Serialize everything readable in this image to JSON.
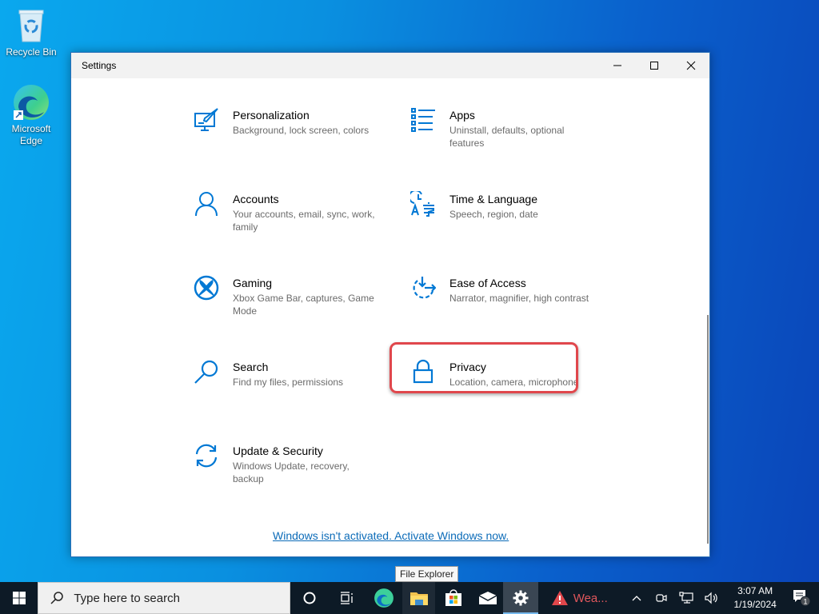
{
  "desktop": {
    "icons": [
      {
        "label": "Recycle Bin",
        "icon": "recycle-bin-icon"
      },
      {
        "label": "Microsoft Edge",
        "icon": "edge-icon"
      }
    ]
  },
  "window": {
    "title": "Settings",
    "controls": {
      "minimize": "minimize",
      "maximize": "maximize",
      "close": "close"
    },
    "tiles": [
      {
        "name": "Personalization",
        "desc": "Background, lock screen, colors",
        "icon": "personalization-icon"
      },
      {
        "name": "Apps",
        "desc": "Uninstall, defaults, optional features",
        "icon": "apps-icon"
      },
      {
        "name": "Accounts",
        "desc": "Your accounts, email, sync, work, family",
        "icon": "accounts-icon"
      },
      {
        "name": "Time & Language",
        "desc": "Speech, region, date",
        "icon": "time-language-icon"
      },
      {
        "name": "Gaming",
        "desc": "Xbox Game Bar, captures, Game Mode",
        "icon": "xbox-icon"
      },
      {
        "name": "Ease of Access",
        "desc": "Narrator, magnifier, high contrast",
        "icon": "ease-of-access-icon"
      },
      {
        "name": "Search",
        "desc": "Find my files, permissions",
        "icon": "search-icon"
      },
      {
        "name": "Privacy",
        "desc": "Location, camera, microphone",
        "icon": "lock-icon"
      },
      {
        "name": "Update & Security",
        "desc": "Windows Update, recovery, backup",
        "icon": "update-icon"
      }
    ],
    "activation_link": "Windows isn't activated. Activate Windows now.",
    "accent_color": "#0078d4",
    "highlight_color": "#e0474c"
  },
  "tooltip": "File Explorer",
  "taskbar": {
    "search_placeholder": "Type here to search",
    "weather_label": "Wea...",
    "clock_time": "3:07 AM",
    "clock_date": "1/19/2024",
    "notification_count": "1"
  }
}
